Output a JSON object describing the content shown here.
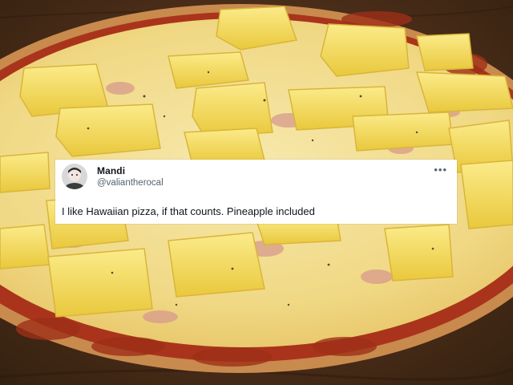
{
  "tweet": {
    "display_name": "Mandi",
    "handle": "@valiantherocal",
    "text": "I like Hawaiian pizza, if that counts. Pineapple included",
    "more_glyph": "•••",
    "avatar_icon": "avatar-photo",
    "more_icon": "more-options-icon"
  },
  "colors": {
    "card_bg": "#ffffff",
    "name": "#0f1419",
    "handle": "#536471",
    "cheese": "#f2dd8c",
    "pineapple": "#f3dc60",
    "sauce": "#b3371e",
    "crust": "#d99a57",
    "table": "#4a2d1c"
  }
}
